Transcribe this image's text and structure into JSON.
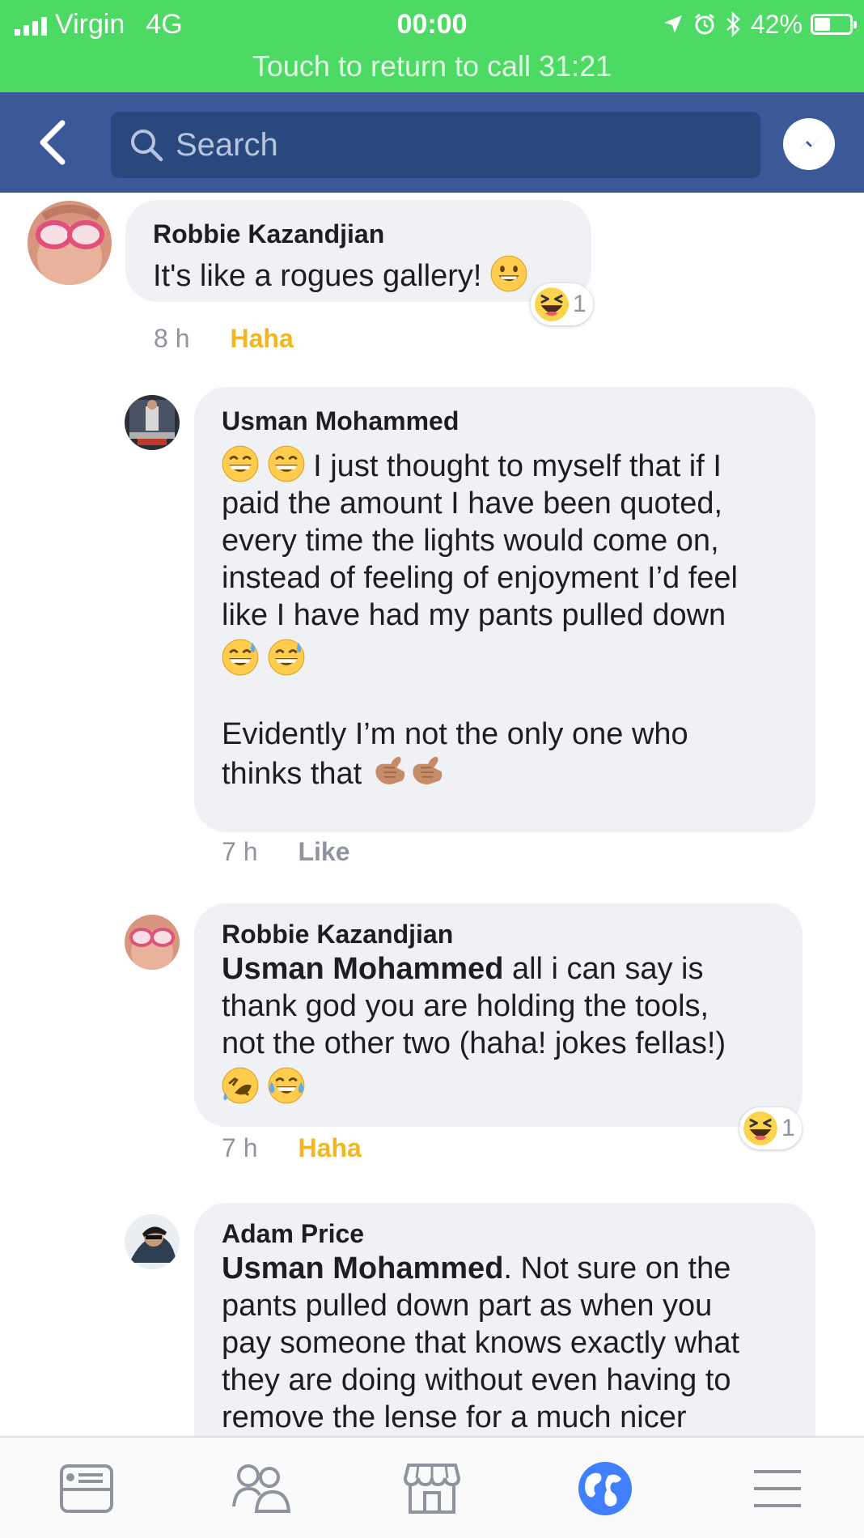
{
  "status_bar": {
    "carrier": "Virgin",
    "network": "4G",
    "time": "00:00",
    "battery": "42%",
    "battery_level": 0.42,
    "call_banner": "Touch to return to call 31:21"
  },
  "search": {
    "placeholder": "Search"
  },
  "comments": [
    {
      "author": "Robbie Kazandjian",
      "text": "It's like a rogues gallery!",
      "time": "8 h",
      "action": "Haha",
      "reaction_count": "1"
    },
    {
      "author": "Usman Mohammed",
      "text_1": "I just thought to myself that if I",
      "text_2": "paid the amount I have been quoted,",
      "text_3": "every time the lights would come on,",
      "text_4": "instead of feeling of enjoyment I’d feel",
      "text_5": "like I have had my pants pulled down",
      "text_6": "Evidently I’m not the only one who",
      "text_7": "thinks that",
      "time": "7 h",
      "action": "Like"
    },
    {
      "author": "Robbie Kazandjian",
      "mention": "Usman Mohammed",
      "text_1": " all i can say is",
      "text_2": "thank god you are holding the tools,",
      "text_3": "not the other two (haha! jokes fellas!)",
      "time": "7 h",
      "action": "Haha",
      "reaction_count": "1"
    },
    {
      "author": "Adam Price",
      "mention": "Usman Mohammed",
      "text_1": ". Not sure on the",
      "text_2": "pants pulled down part as when you",
      "text_3": "pay someone that knows exactly what",
      "text_4": "they are doing without even having to",
      "text_5": "remove the lense for a much nicer"
    }
  ],
  "colors": {
    "status_green": "#4cd964",
    "facebook_blue": "#3b5998",
    "haha_yellow": "#f0b722",
    "bubble_gray": "#f0f1f5"
  },
  "icons": [
    "back-chevron-icon",
    "search-icon",
    "messenger-icon",
    "news-feed-icon",
    "friends-icon",
    "marketplace-icon",
    "notifications-globe-icon",
    "menu-icon"
  ]
}
